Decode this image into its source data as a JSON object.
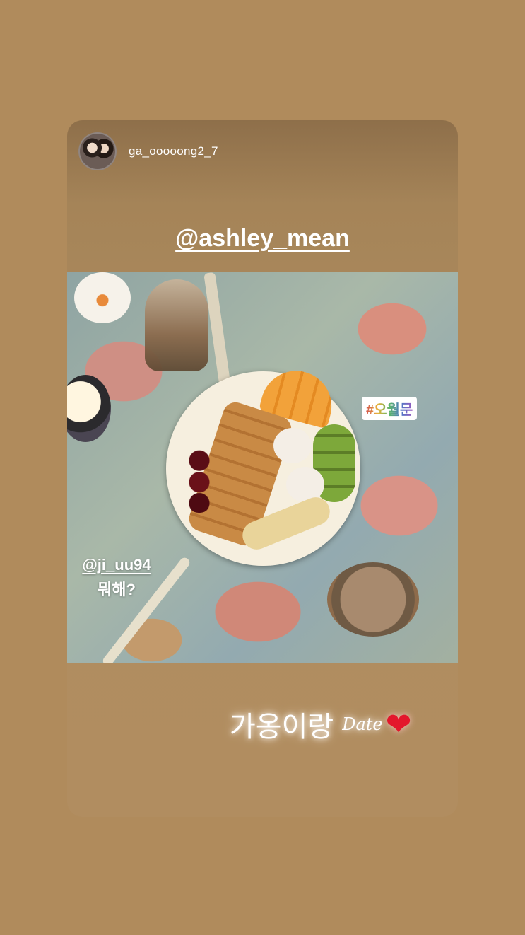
{
  "story": {
    "username": "ga_ooooong2_7",
    "mention_top": "@ashley_mean",
    "hashtag": "#오월문",
    "photo_mention": "@ji_uu94",
    "photo_mention_sub": "뭐해?",
    "caption_korean": "가옹이랑",
    "caption_script": "Date",
    "caption_emoji": "❤"
  }
}
